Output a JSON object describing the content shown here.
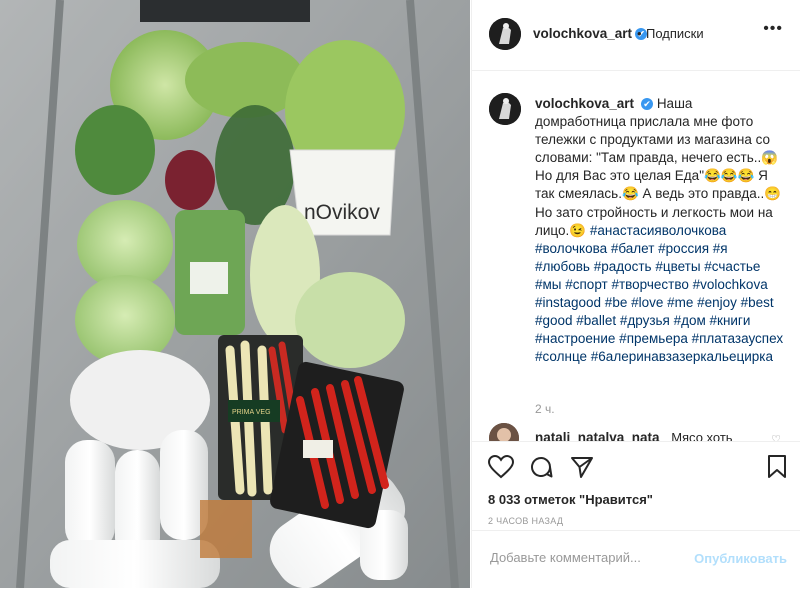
{
  "header": {
    "username": "volochkova_art",
    "verified_glyph": "✔",
    "separator": "•",
    "follow_label": "Подписки",
    "more_icon": "more-icon"
  },
  "caption": {
    "username": "volochkova_art",
    "text": "Наша домработница прислала мне фото тележки с продуктами из магазина со словами: \"Там правда, нечего есть..😱 Но для Вас это целая Еда\"😂😂😂 Я так смеялась.😂 А ведь это правда..😁 Но зато стройность и легкость мои на лицо.😉",
    "hashtags": "#анастасияволочкова #волочкова #балет #россия #я #любовь #радость #цветы #счастье #мы #спорт #творчество #volochkova #instagood #be #love #me #enjoy #best #good #ballet #друзья #дом #книги #настроение #премьера #платазауспех #солнце #6алеринавзазеркальецирка",
    "time_ago": "2 ч."
  },
  "comment": {
    "username": "natali_natalva_nata",
    "text": "Мясо хоть"
  },
  "actions": {
    "like_icon": "heart-icon",
    "comment_icon": "comment-icon",
    "share_icon": "share-icon",
    "save_icon": "bookmark-icon",
    "likes_text": "8 033 отметок \"Нравится\"",
    "posted": "2 ЧАСОВ НАЗАД"
  },
  "add_comment": {
    "placeholder": "Добавьте комментарий...",
    "post_label": "Опубликовать"
  },
  "photo": {
    "bag_label": "nOvikov",
    "sticker_label": "PRIMA VEG"
  },
  "colors": {
    "verified": "#3897f0",
    "hashtag": "#003569",
    "post_button_disabled": "#b2dffc"
  }
}
